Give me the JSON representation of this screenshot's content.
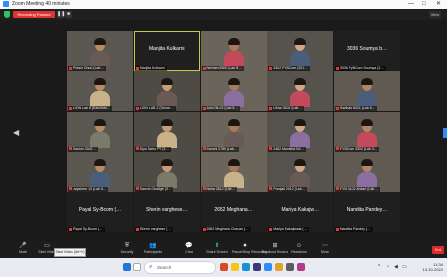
{
  "window": {
    "title": "Zoom Meeting 40 minutes",
    "minimize": "—",
    "maximize": "□",
    "close": "✕"
  },
  "meeting_bar": {
    "recording_label": "Recording Paused",
    "pause_icon": "❚❚",
    "stop_icon": "■",
    "view_label": "View"
  },
  "participants": [
    {
      "label": "Pritam Dhuri (Lab…",
      "style": "video"
    },
    {
      "label": "Manjita Kulkarni",
      "big": "Manjita Kulkarni",
      "style": "name",
      "highlight": true
    },
    {
      "label": "Neelam 8300 (Lab 8…",
      "style": "video"
    },
    {
      "label": "3302 FYBCom (201…",
      "style": "video"
    },
    {
      "label": "3036 FyBCom Soumya (2…",
      "big": "3036 Soumya b…",
      "style": "name"
    },
    {
      "label": "LION Lab 6 (Kanchan…",
      "style": "video"
    },
    {
      "label": "LION LAB 2 (Deore…",
      "style": "video"
    },
    {
      "label": "Abhi 08-02 (Lab 5…",
      "style": "video"
    },
    {
      "label": "Ubha 3302 (Lab…",
      "style": "video"
    },
    {
      "label": "Sarthak 8031 (Lab 8…",
      "style": "video"
    },
    {
      "label": "Sachin 3302…",
      "style": "video"
    },
    {
      "label": "Diya Sahu FY (3…",
      "style": "video"
    },
    {
      "label": "Sanchi 2789 (Lab…",
      "style": "video"
    },
    {
      "label": "2482 Manisha Ka…",
      "style": "video"
    },
    {
      "label": "FYBCom 3302 (Lab 3…",
      "style": "video"
    },
    {
      "label": "Jayshree 12 (Lab 5…",
      "style": "video"
    },
    {
      "label": "Sanchi Ghadge (3…",
      "style": "video"
    },
    {
      "label": "Neha 2812 (Lab…",
      "style": "video"
    },
    {
      "label": "Pranjali 2012 (Lab…",
      "style": "video"
    },
    {
      "label": "FYB 3102 Ansari (Lab…",
      "style": "video"
    },
    {
      "label": "Payal Sy-Bcom (…",
      "big": "Payal Sy-Bcom (…",
      "style": "name"
    },
    {
      "label": "Sherin varghese (…",
      "big": "Sherin varghese…",
      "style": "name"
    },
    {
      "label": "2652 Meghana Chavan (…",
      "big": "2652 Meghana…",
      "style": "name"
    },
    {
      "label": "Mariya Kakajiwala (…",
      "big": "Mariya Kakajw…",
      "style": "name"
    },
    {
      "label": "Nandita Pandey (…",
      "big": "Nandita Pandey…",
      "style": "name"
    }
  ],
  "toolbar": {
    "items": [
      {
        "icon": "🎤",
        "label": "Mute"
      },
      {
        "icon": "▭",
        "label": "Start Video"
      },
      {
        "icon": "⛨",
        "label": "Security"
      },
      {
        "icon": "👥",
        "label": "Participants"
      },
      {
        "icon": "💬",
        "label": "Chat"
      },
      {
        "icon": "⬆",
        "label": "Share Screen"
      },
      {
        "icon": "⏺",
        "label": "Pause/Stop Recording"
      },
      {
        "icon": "⊞",
        "label": "Breakout Rooms"
      },
      {
        "icon": "☺",
        "label": "Reactions"
      },
      {
        "icon": "⋯",
        "label": "More"
      }
    ],
    "end_label": "End",
    "tooltip": "Start Video (Alt+V)"
  },
  "taskbar": {
    "search_placeholder": "Search",
    "time": "11:34",
    "date": "13-10-2022"
  }
}
